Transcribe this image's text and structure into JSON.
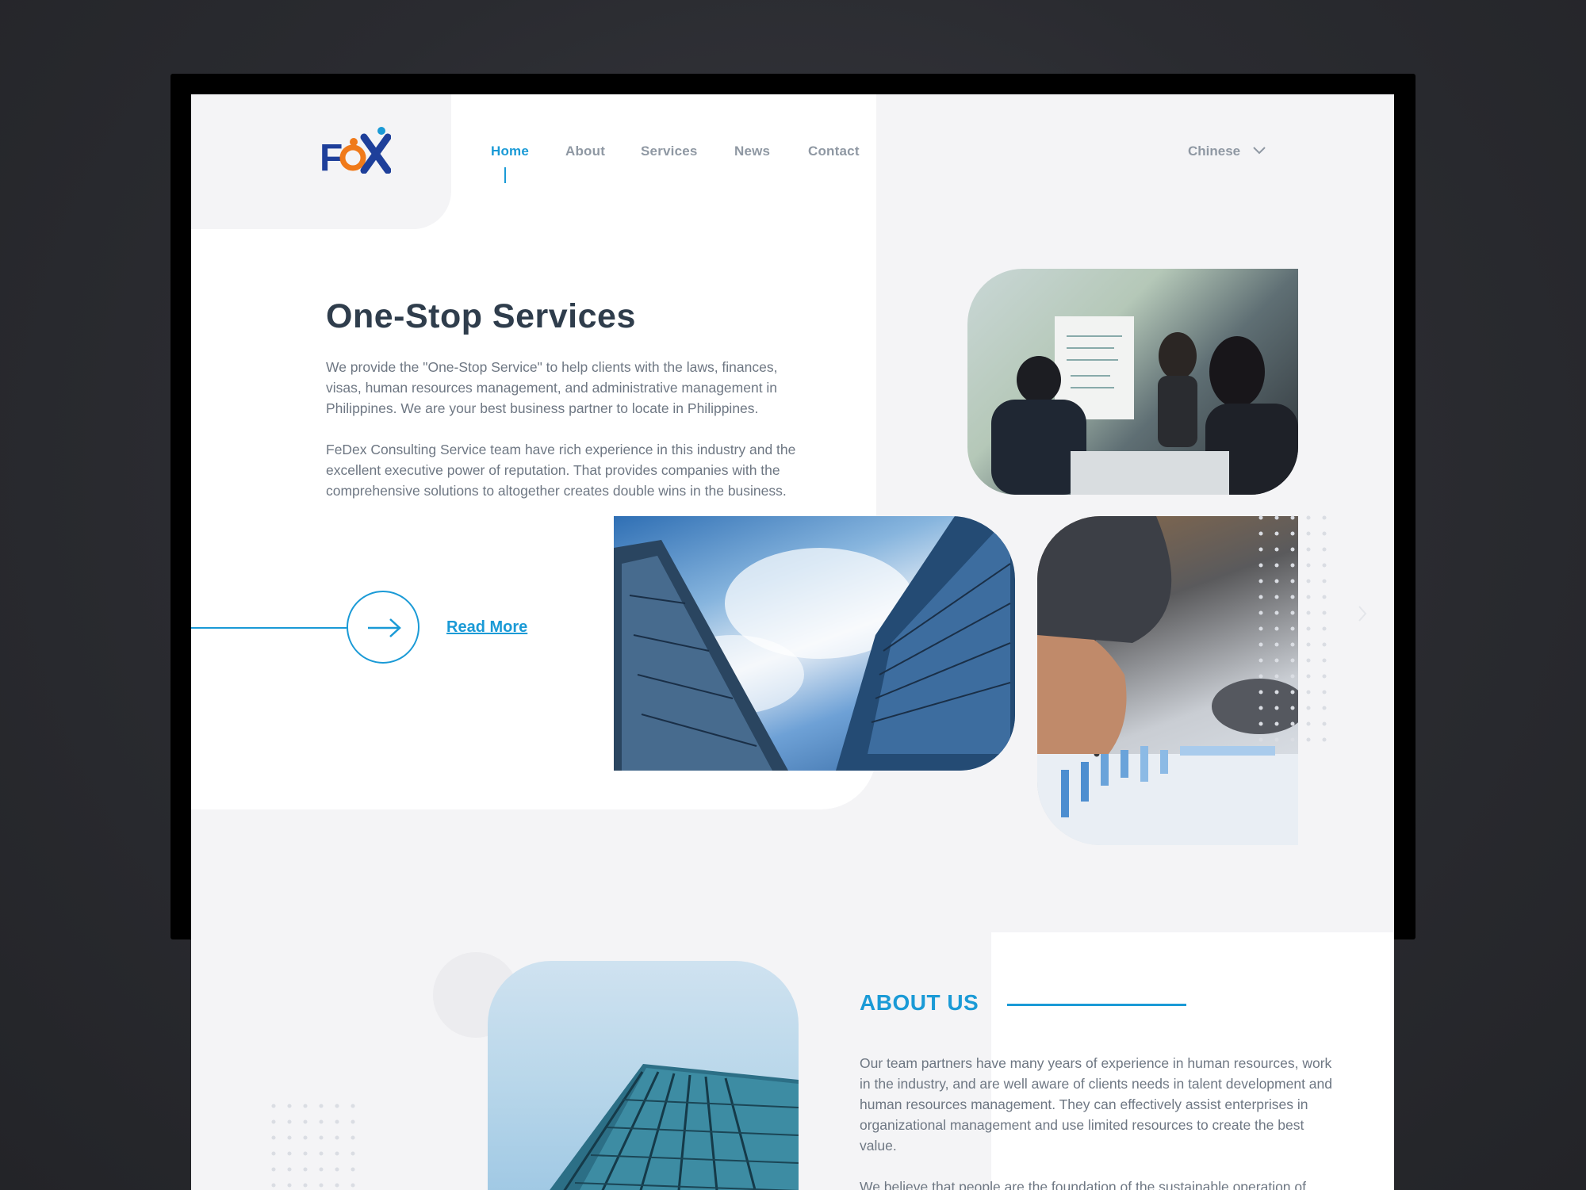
{
  "nav": {
    "items": [
      {
        "label": "Home",
        "active": true
      },
      {
        "label": "About",
        "active": false
      },
      {
        "label": "Services",
        "active": false
      },
      {
        "label": "News",
        "active": false
      },
      {
        "label": "Contact",
        "active": false
      }
    ],
    "language": "Chinese",
    "language_icon": "chevron-down-icon"
  },
  "brand": {
    "logo_text": "FOX",
    "colors": {
      "primary": "#1a9ad6",
      "logo_blue": "#1e3f9a",
      "logo_orange": "#f07a1a",
      "heading": "#2f3d4c"
    }
  },
  "hero": {
    "title": "One-Stop Services",
    "paragraph_1": "We provide the \"One-Stop Service\" to help clients with the laws, finances, visas, human resources management, and administrative management in Philippines. We are your best business partner to locate in Philippines.",
    "paragraph_2": "FeDex Consulting Service team have rich experience in this industry and the excellent executive power of reputation. That provides companies with the comprehensive solutions to altogether creates double wins in the business.",
    "read_more": "Read More",
    "read_more_icon": "arrow-right-icon",
    "images": [
      "business-meeting-photo",
      "glass-buildings-photo",
      "pen-chart-photo"
    ]
  },
  "about": {
    "title": "ABOUT US",
    "paragraph_1": "Our team partners have many years of experience in human resources, work in the industry, and are well aware of clients needs in talent development and human resources management. They can effectively assist enterprises in organizational management and use limited resources to create the best value.",
    "paragraph_2": "We believe that people are the foundation of the sustainable operation of",
    "image": "tower-photo"
  }
}
